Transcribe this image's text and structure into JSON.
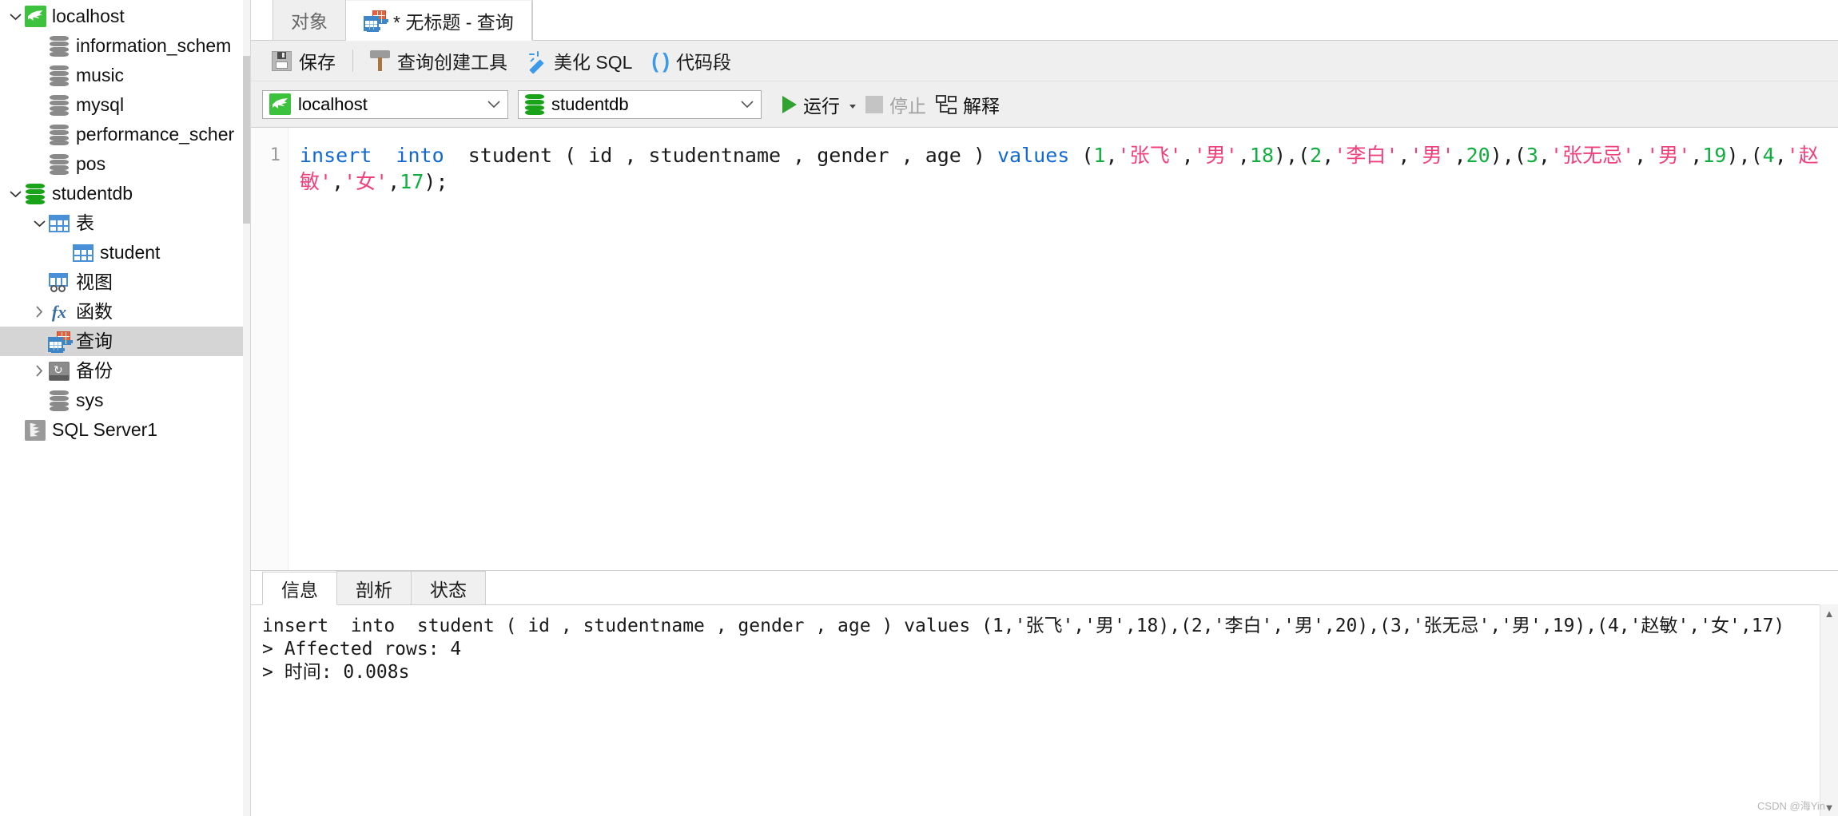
{
  "sidebar": {
    "items": [
      {
        "label": "localhost",
        "icon": "mysql-connection-icon",
        "indent": 0,
        "twisty": "down",
        "selected": false
      },
      {
        "label": "information_schem",
        "icon": "database-icon-gray",
        "indent": 1,
        "twisty": "",
        "selected": false
      },
      {
        "label": "music",
        "icon": "database-icon-gray",
        "indent": 1,
        "twisty": "",
        "selected": false
      },
      {
        "label": "mysql",
        "icon": "database-icon-gray",
        "indent": 1,
        "twisty": "",
        "selected": false
      },
      {
        "label": "performance_scher",
        "icon": "database-icon-gray",
        "indent": 1,
        "twisty": "",
        "selected": false
      },
      {
        "label": "pos",
        "icon": "database-icon-gray",
        "indent": 1,
        "twisty": "",
        "selected": false
      },
      {
        "label": "studentdb",
        "icon": "database-icon-green",
        "indent": 0,
        "twisty": "down",
        "selected": false
      },
      {
        "label": "表",
        "icon": "table-grid-icon",
        "indent": 1,
        "twisty": "down",
        "selected": false
      },
      {
        "label": "student",
        "icon": "table-grid-icon",
        "indent": 2,
        "twisty": "",
        "selected": false
      },
      {
        "label": "视图",
        "icon": "view-icon",
        "indent": 1,
        "twisty": "",
        "selected": false
      },
      {
        "label": "函数",
        "icon": "function-fx-icon",
        "indent": 1,
        "twisty": "right",
        "selected": false
      },
      {
        "label": "查询",
        "icon": "query-icon",
        "indent": 1,
        "twisty": "",
        "selected": true
      },
      {
        "label": "备份",
        "icon": "backup-icon",
        "indent": 1,
        "twisty": "right",
        "selected": false
      },
      {
        "label": "sys",
        "icon": "database-icon-gray",
        "indent": 1,
        "twisty": "",
        "selected": false
      },
      {
        "label": "SQL Server1",
        "icon": "sqlserver-connection-icon",
        "indent": 0,
        "twisty": "",
        "selected": false
      }
    ]
  },
  "tabs": {
    "objects_tab": "对象",
    "query_tab": "* 无标题 - 查询"
  },
  "toolbar": {
    "save_label": "保存",
    "query_builder_label": "查询创建工具",
    "beautify_label": "美化 SQL",
    "snippet_label": "代码段"
  },
  "connbar": {
    "connection": "localhost",
    "database": "studentdb",
    "run_label": "运行",
    "stop_label": "停止",
    "explain_label": "解释"
  },
  "editor": {
    "line_number": "1",
    "tokens": [
      {
        "t": "insert",
        "c": "kw"
      },
      {
        "t": "  ",
        "c": "pl"
      },
      {
        "t": "into",
        "c": "kw"
      },
      {
        "t": "  student ( id , studentname , gender , age ) ",
        "c": "pl"
      },
      {
        "t": "values",
        "c": "kw"
      },
      {
        "t": " (",
        "c": "pl"
      },
      {
        "t": "1",
        "c": "num"
      },
      {
        "t": ",",
        "c": "pl"
      },
      {
        "t": "'张飞'",
        "c": "str"
      },
      {
        "t": ",",
        "c": "pl"
      },
      {
        "t": "'男'",
        "c": "str"
      },
      {
        "t": ",",
        "c": "pl"
      },
      {
        "t": "18",
        "c": "num"
      },
      {
        "t": "),(",
        "c": "pl"
      },
      {
        "t": "2",
        "c": "num"
      },
      {
        "t": ",",
        "c": "pl"
      },
      {
        "t": "'李白'",
        "c": "str"
      },
      {
        "t": ",",
        "c": "pl"
      },
      {
        "t": "'男'",
        "c": "str"
      },
      {
        "t": ",",
        "c": "pl"
      },
      {
        "t": "20",
        "c": "num"
      },
      {
        "t": "),(",
        "c": "pl"
      },
      {
        "t": "3",
        "c": "num"
      },
      {
        "t": ",",
        "c": "pl"
      },
      {
        "t": "'张无忌'",
        "c": "str"
      },
      {
        "t": ",",
        "c": "pl"
      },
      {
        "t": "'男'",
        "c": "str"
      },
      {
        "t": ",",
        "c": "pl"
      },
      {
        "t": "19",
        "c": "num"
      },
      {
        "t": "),(",
        "c": "pl"
      },
      {
        "t": "4",
        "c": "num"
      },
      {
        "t": ",",
        "c": "pl"
      },
      {
        "t": "'赵敏'",
        "c": "str"
      },
      {
        "t": ",",
        "c": "pl"
      },
      {
        "t": "'女'",
        "c": "str"
      },
      {
        "t": ",",
        "c": "pl"
      },
      {
        "t": "17",
        "c": "num"
      },
      {
        "t": ");",
        "c": "pl"
      }
    ]
  },
  "results": {
    "tabs": [
      {
        "label": "信息",
        "active": true
      },
      {
        "label": "剖析",
        "active": false
      },
      {
        "label": "状态",
        "active": false
      }
    ],
    "output": "insert  into  student ( id , studentname , gender , age ) values (1,'张飞','男',18),(2,'李白','男',20),(3,'张无忌','男',19),(4,'赵敏','女',17)\n> Affected rows: 4\n> 时间: 0.008s"
  },
  "watermark": "CSDN @海Yin"
}
